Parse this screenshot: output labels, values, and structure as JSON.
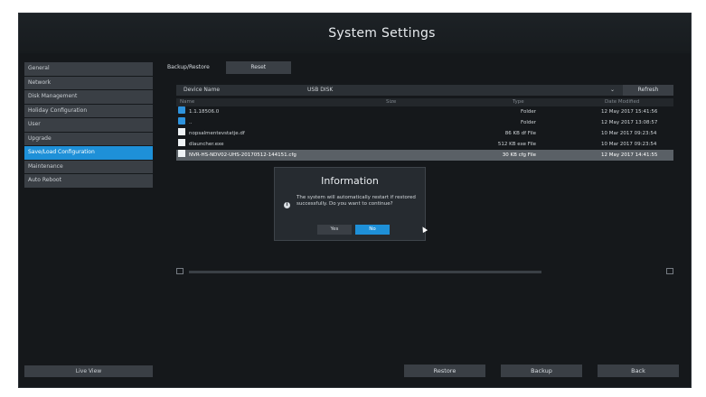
{
  "window": {
    "title": "System Settings"
  },
  "sidebar": {
    "items": [
      {
        "label": "General"
      },
      {
        "label": "Network"
      },
      {
        "label": "Disk Management"
      },
      {
        "label": "Holiday Configuration"
      },
      {
        "label": "User"
      },
      {
        "label": "Upgrade"
      },
      {
        "label": "Save/Load Configuration",
        "active": true
      },
      {
        "label": "Maintenance"
      },
      {
        "label": "Auto Reboot"
      }
    ],
    "live_view": "Live View"
  },
  "tabs": {
    "backup_restore": "Backup/Restore",
    "reset": "Reset"
  },
  "device": {
    "label": "Device Name",
    "value": "USB DISK",
    "refresh": "Refresh"
  },
  "table": {
    "headers": {
      "name": "Name",
      "size": "Size",
      "type": "Type",
      "date": "Date Modified"
    },
    "rows": [
      {
        "icon": "folder-icon",
        "name": "1.1.18506.0",
        "size": "",
        "type": "Folder",
        "date": "12 May 2017 15:41:56"
      },
      {
        "icon": "folder-icon",
        "name": "..",
        "size": "",
        "type": "Folder",
        "date": "12 May 2017 13:08:57"
      },
      {
        "icon": "file-icon",
        "name": "nopsalmentevstatje.df",
        "size": "",
        "type": "86 KB df File",
        "date": "10 Mar 2017 09:23:54"
      },
      {
        "icon": "file-icon",
        "name": "dlauncher.exe",
        "size": "",
        "type": "512 KB exe File",
        "date": "10 Mar 2017 09:23:54"
      },
      {
        "icon": "file-icon",
        "name": "NVR-HS-NDV02-UHS-20170512-144151.cfg",
        "size": "",
        "type": "30 KB cfg File",
        "date": "12 May 2017 14:41:55",
        "selected": true
      }
    ]
  },
  "dialog": {
    "title": "Information",
    "message": "The system will automatically restart if restored successfully. Do you want to continue?",
    "yes": "Yes",
    "no": "No"
  },
  "buttons": {
    "restore": "Restore",
    "backup": "Backup",
    "back": "Back"
  },
  "colors": {
    "accent": "#1e90d8",
    "background": "#15181b"
  }
}
